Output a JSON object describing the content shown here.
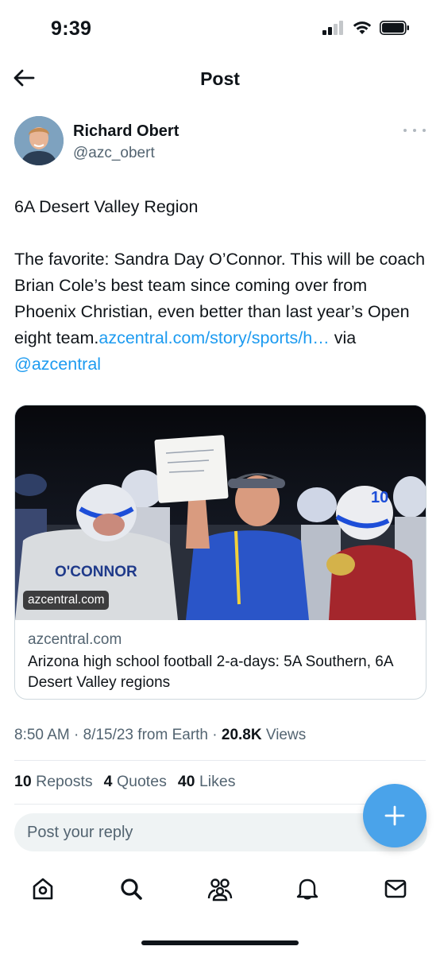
{
  "status_bar": {
    "time": "9:39"
  },
  "header": {
    "title": "Post"
  },
  "author": {
    "name": "Richard Obert",
    "handle": "@azc_obert"
  },
  "tweet": {
    "line1": "6A Desert Valley Region",
    "body": "The favorite: Sandra Day O’Connor. This will be coach Brian Cole’s best team since  coming over from Phoenix Christian, even better than last  year’s Open eight  team.",
    "link_text": "azcentral.com/story/sports/h…",
    "via_text": " via ",
    "mention": "@azcentral"
  },
  "card": {
    "image_overlay": "azcentral.com",
    "domain": "azcentral.com",
    "title": "Arizona high school football 2-a-days: 5A Southern, 6A Desert Valley regions"
  },
  "meta": {
    "time": "8:50 AM",
    "date": "8/15/23",
    "source": "from Earth",
    "views_count": "20.8K",
    "views_label": "Views"
  },
  "stats": {
    "reposts_count": "10",
    "reposts_label": "Reposts",
    "quotes_count": "4",
    "quotes_label": "Quotes",
    "likes_count": "40",
    "likes_label": "Likes"
  },
  "reply": {
    "placeholder": "Post your reply"
  },
  "icons": {
    "back": "arrow-left-icon",
    "more": "more-horizontal-icon",
    "compose": "plus-icon",
    "tabs": [
      "home-icon",
      "search-icon",
      "communities-icon",
      "notifications-icon",
      "messages-icon"
    ]
  },
  "colors": {
    "accent": "#1d9bf0",
    "fab": "#4aa3ea",
    "secondary_text": "#536471"
  }
}
